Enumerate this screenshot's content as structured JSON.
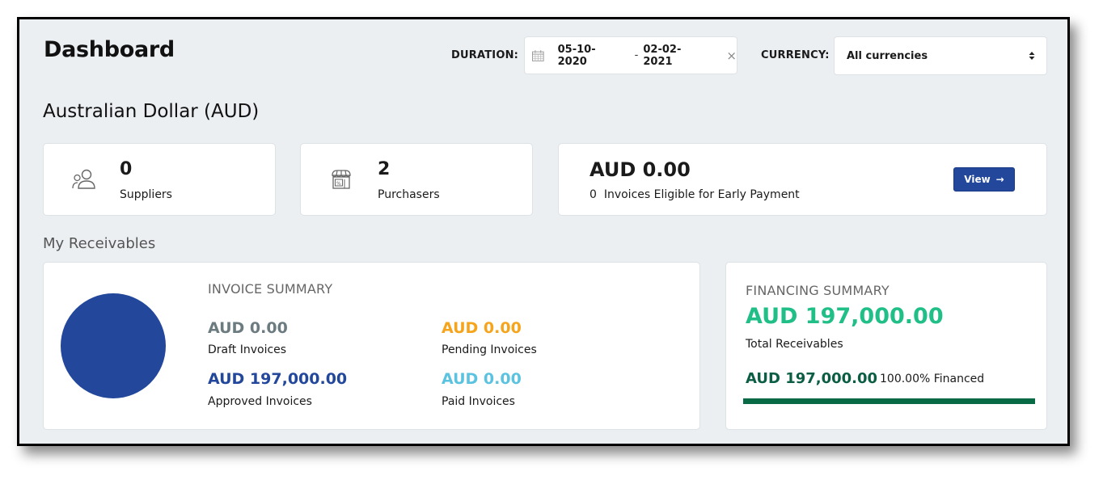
{
  "header": {
    "title": "Dashboard",
    "duration_label": "DURATION:",
    "date_from": "05-10-2020",
    "date_separator": "-",
    "date_to": "02-02-2021",
    "clear_icon": "×",
    "currency_label": "CURRENCY:",
    "currency_selected": "All currencies"
  },
  "currency_section": {
    "title": "Australian Dollar (AUD)"
  },
  "stats": {
    "suppliers": {
      "value": "0",
      "label": "Suppliers",
      "icon": "users-icon"
    },
    "purchasers": {
      "value": "2",
      "label": "Purchasers",
      "icon": "store-icon"
    },
    "early_payment": {
      "amount": "AUD 0.00",
      "count": "0",
      "label": "Invoices Eligible for Early Payment",
      "button_label": "View",
      "button_icon": "→"
    }
  },
  "receivables": {
    "title": "My Receivables",
    "invoice_summary": {
      "title": "INVOICE SUMMARY",
      "items": [
        {
          "amount": "AUD 0.00",
          "label": "Draft Invoices",
          "color": "#6b7b80"
        },
        {
          "amount": "AUD 0.00",
          "label": "Pending Invoices",
          "color": "#f5a41c"
        },
        {
          "amount": "AUD 197,000.00",
          "label": "Approved Invoices",
          "color": "#22479b"
        },
        {
          "amount": "AUD 0.00",
          "label": "Paid Invoices",
          "color": "#5bc3e0"
        }
      ]
    },
    "financing_summary": {
      "title": "FINANCING SUMMARY",
      "total_amount": "AUD 197,000.00",
      "total_label": "Total Receivables",
      "financed_amount": "AUD 197,000.00",
      "financed_percent_label": "100.00% Financed",
      "financed_fraction": 1.0,
      "colors": {
        "total": "#20bf87",
        "financed": "#0b5e44",
        "bar": "#086b45"
      }
    }
  },
  "chart_data": {
    "type": "pie",
    "title": "Invoice Summary",
    "categories": [
      "Draft Invoices",
      "Pending Invoices",
      "Approved Invoices",
      "Paid Invoices"
    ],
    "values": [
      0,
      0,
      197000,
      0
    ],
    "colors": [
      "#6b7b80",
      "#f5a41c",
      "#22479b",
      "#5bc3e0"
    ],
    "unit": "AUD"
  }
}
